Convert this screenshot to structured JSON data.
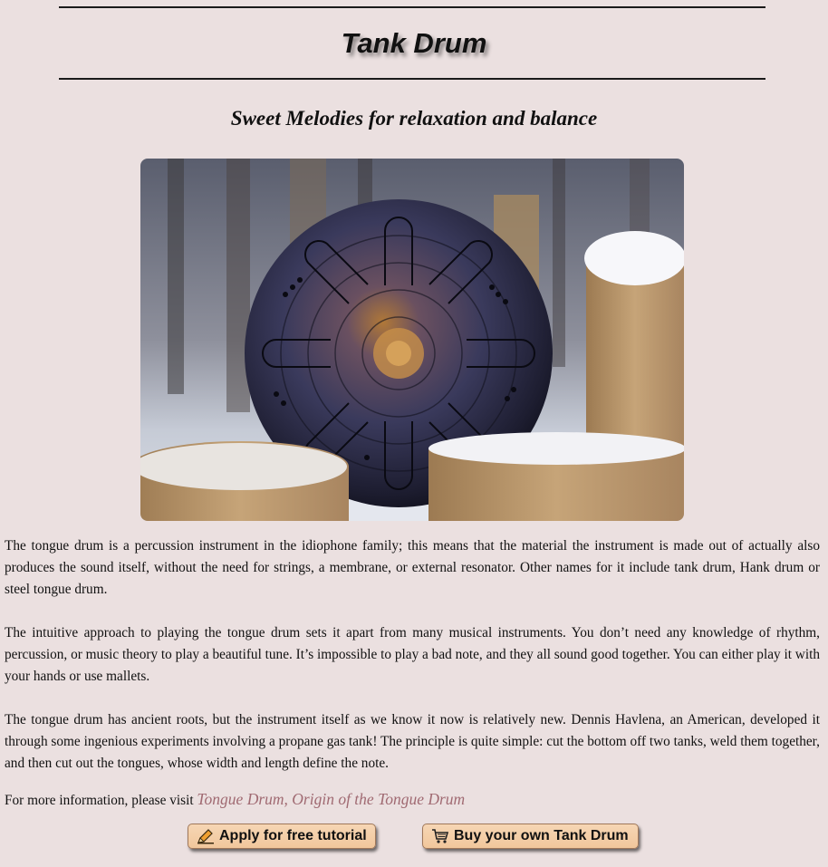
{
  "header": {
    "title": "Tank Drum",
    "subtitle": "Sweet Melodies for relaxation and balance"
  },
  "hero_image": {
    "alt": "Tank drum on snowy tree stumps"
  },
  "article": {
    "paragraphs": [
      "The tongue drum is a percussion instrument in the idiophone family; this means that the material the instrument is made out of actually also produces the sound itself, without the need for strings, a membrane, or external resonator. Other names for it include tank drum, Hank drum or steel tongue drum.",
      "The intuitive approach to playing the tongue drum sets it apart from many musical instruments. You don’t need any knowledge of rhythm, percussion, or music theory to play a beautiful tune. It’s impossible to play a bad note, and they all sound good together. You can either play it with your hands or use mallets.",
      "The tongue drum has ancient roots, but the instrument itself as we know it now is relatively new. Dennis Havlena, an American, developed it through some ingenious experiments involving a propane gas tank! The principle is quite simple: cut the bottom off two tanks, weld them together, and then cut out the tongues, whose width and length define the note."
    ],
    "info_prefix": "For more information, please visit ",
    "info_link": "Tongue Drum, Origin of the Tongue Drum"
  },
  "buttons": {
    "tutorial": {
      "label": "Apply for free tutorial",
      "icon": "pencil-icon"
    },
    "buy": {
      "label": "Buy your own Tank Drum",
      "icon": "cart-icon"
    }
  },
  "colors": {
    "background": "#ebe0e0",
    "link": "#a06a72",
    "button": "#f1c79c"
  }
}
